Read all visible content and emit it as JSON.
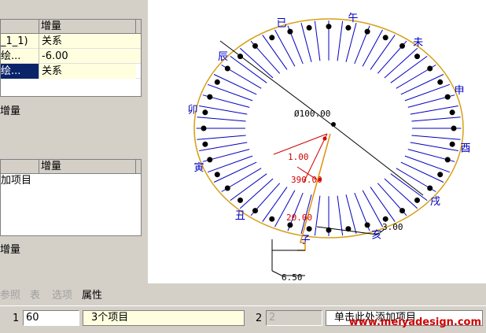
{
  "left_panel": {
    "grid_top": {
      "header": "增量",
      "rows": [
        {
          "c1": "_1_1)",
          "c2": "关系"
        },
        {
          "c1": "绘...",
          "c2": "-6.00"
        },
        {
          "c1": "绘...",
          "c2": "关系"
        }
      ]
    },
    "label_top": "增量",
    "grid_bottom": {
      "header": "增量",
      "row": "加项目"
    },
    "label_bottom": "增量"
  },
  "canvas": {
    "dims": {
      "diameter": "Ø100.00",
      "d1": "1.00",
      "d2": "390.00",
      "d3": "20.00",
      "d4": "3.00",
      "d5": "6.50"
    },
    "glyphs": [
      "已",
      "午",
      "未",
      "申",
      "酉",
      "戌",
      "亥",
      "子",
      "丑",
      "寅",
      "卯",
      "辰"
    ],
    "colors": {
      "ellipse": "#d4a017",
      "blue": "#0000c0",
      "red": "#d00000",
      "dark": "#000000"
    }
  },
  "tabs": {
    "ref": "参照",
    "table": "表",
    "options": "选项",
    "properties": "属性"
  },
  "status_bar": {
    "num1": "1",
    "value1": "60",
    "items": "3个项目",
    "num2": "2",
    "value2": "2",
    "hint": "单击此处添加项目"
  },
  "watermark": "www.meiyadesign.com"
}
